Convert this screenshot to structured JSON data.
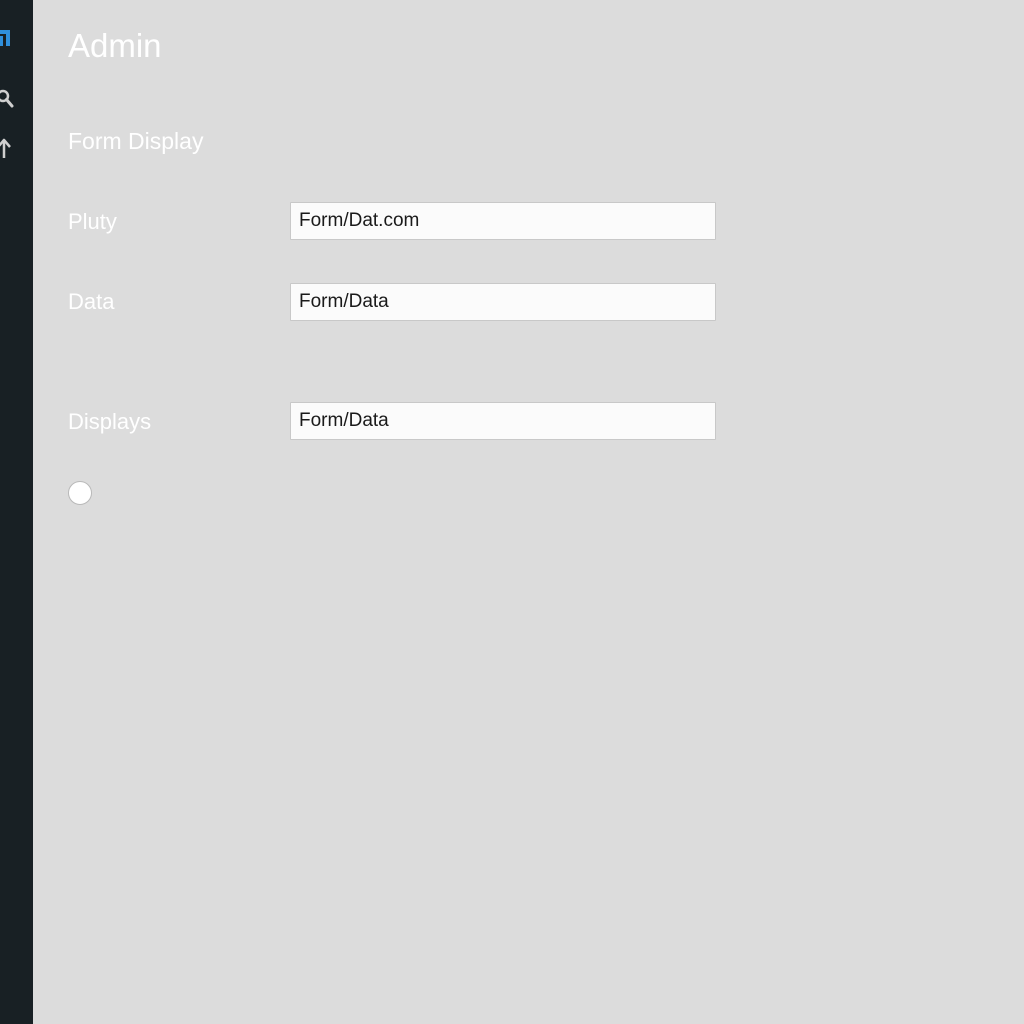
{
  "colors": {
    "sidebar_bg": "#182024",
    "main_bg": "#dcdcdc",
    "accent": "#2f8fdc",
    "label_text": "#ffffff",
    "input_bg": "#fbfbfb"
  },
  "sidebar": {
    "icons": [
      {
        "name": "app-logo-icon"
      },
      {
        "name": "search-icon"
      },
      {
        "name": "arrow-up-icon"
      }
    ]
  },
  "header": {
    "title": "Admin"
  },
  "form": {
    "section_title": "Form Display",
    "fields": [
      {
        "label": "Pluty",
        "value": "Form/Dat.com"
      },
      {
        "label": "Data",
        "value": "Form/Data"
      },
      {
        "label": "Displays",
        "value": "Form/Data"
      }
    ]
  }
}
